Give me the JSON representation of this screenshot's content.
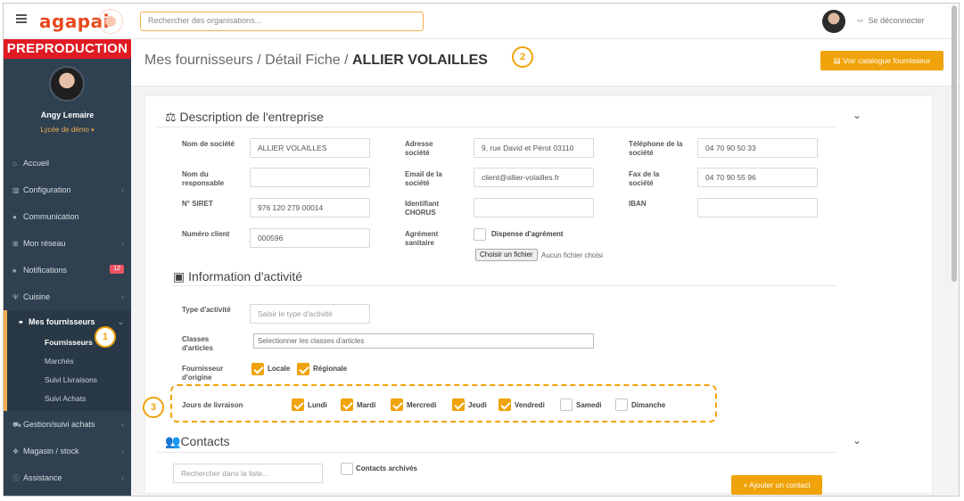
{
  "topbar": {
    "logo": "agapai",
    "search_placeholder": "Rechercher des organisations...",
    "logout_label": "Se déconnecter"
  },
  "sidebar": {
    "env_label": "PREPRODUCTION",
    "user_name": "Angy Lemaire",
    "org_name": "Lycée de démo",
    "items": [
      {
        "label": "Accueil",
        "icon": "home-icon"
      },
      {
        "label": "Configuration",
        "icon": "bank-icon"
      },
      {
        "label": "Communication",
        "icon": "chat-icon"
      },
      {
        "label": "Mon réseau",
        "icon": "sitemap-icon"
      },
      {
        "label": "Notifications",
        "icon": "bell-icon",
        "badge": "12"
      },
      {
        "label": "Cuisine",
        "icon": "cutlery-icon"
      },
      {
        "label": "Mes fournisseurs",
        "icon": "handshake-icon"
      },
      {
        "label": "Gestion/suivi achats",
        "icon": "cart-icon"
      },
      {
        "label": "Magasin / stock",
        "icon": "cubes-icon"
      },
      {
        "label": "Assistance",
        "icon": "info-icon"
      }
    ],
    "sub_items": [
      "Fournisseurs",
      "Marchés",
      "Suivi Livraisons",
      "Suivi Achats"
    ]
  },
  "header": {
    "crumb_prefix": "Mes fournisseurs / Détail Fiche / ",
    "crumb_current": "ALLIER VOLAILLES",
    "catalogue_button": "Voir catalogue fournisseur"
  },
  "description": {
    "title": "Description de l'entreprise",
    "fields": {
      "nom_societe_label": "Nom de société",
      "nom_societe_value": "ALLIER VOLAILLES",
      "adresse_label": "Adresse société",
      "adresse_value": "9, rue David et Pérot  03110",
      "telephone_label": "Téléphone de la société",
      "telephone_value": "04 70 90 50 33",
      "responsable_label": "Nom du responsable",
      "responsable_value": "",
      "email_label": "Email de la société",
      "email_value": "client@allier-volailles.fr",
      "fax_label": "Fax de la société",
      "fax_value": "04 70 90 55 96",
      "siret_label": "N° SIRET",
      "siret_value": "976 120 279 00014",
      "chorus_label": "Identifiant CHORUS",
      "chorus_value": "",
      "iban_label": "IBAN",
      "iban_value": "",
      "client_label": "Numéro client",
      "client_value": "000596",
      "agrement_label": "Agrément sanitaire",
      "dispense_label": "Dispense d'agrément",
      "file_button": "Choisir un fichier",
      "file_status": "Aucun fichier choisi"
    }
  },
  "activite": {
    "title": "Information d'activité",
    "type_label": "Type d'activité",
    "type_placeholder": "Saisir le type d'activité",
    "classes_label": "Classes d'articles",
    "classes_placeholder": "Selectionner les classes d'articles",
    "origine_label": "Fournisseur d'origine",
    "origine_options": [
      {
        "label": "Locale",
        "checked": true
      },
      {
        "label": "Régionale",
        "checked": true
      }
    ],
    "jours_label": "Jours de livraison",
    "jours": [
      {
        "label": "Lundi",
        "checked": true
      },
      {
        "label": "Mardi",
        "checked": true
      },
      {
        "label": "Mercredi",
        "checked": true
      },
      {
        "label": "Jeudi",
        "checked": true
      },
      {
        "label": "Vendredi",
        "checked": true
      },
      {
        "label": "Samedi",
        "checked": false
      },
      {
        "label": "Dimanche",
        "checked": false
      }
    ]
  },
  "contacts": {
    "title": "Contacts",
    "search_placeholder": "Rechercher dans la liste...",
    "archived_label": "Contacts archivés",
    "add_button": "+ Ajouter un contact"
  },
  "markers": [
    "1",
    "2",
    "3"
  ],
  "colors": {
    "accent": "#f0a30a",
    "brand": "#e8491d",
    "sidebar": "#2f4050",
    "env_banner": "#e01b24"
  }
}
